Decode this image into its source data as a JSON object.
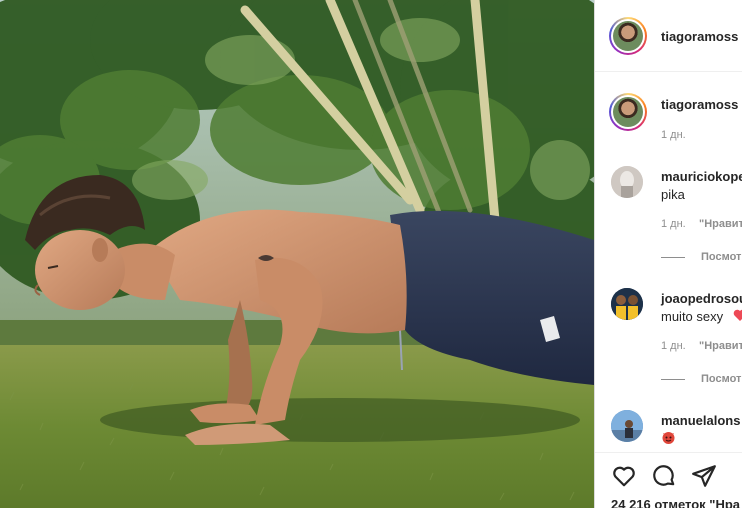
{
  "post": {
    "author": "tiagoramoss",
    "caption_author": "tiagoramoss",
    "caption_time": "1 дн."
  },
  "comments": [
    {
      "user": "mauriciokope",
      "text": "pika",
      "time": "1 дн.",
      "like_label": "\"Нравит",
      "replies": "Посмот"
    },
    {
      "user": "joaopedrosou",
      "text": "muito sexy",
      "time": "1 дн.",
      "like_label": "\"Нравит",
      "replies": "Посмот"
    },
    {
      "user": "manuelalons"
    }
  ],
  "actions": {
    "like_icon": "heart-outline-icon",
    "comment_icon": "speech-bubble-icon",
    "share_icon": "paper-plane-icon",
    "likes_text": "24 216 отметок \"Нра"
  },
  "colors": {
    "link_gray": "#8e8e8e",
    "text": "#262626",
    "heart_red": "#ed4956",
    "grass": "#6f8a3a"
  }
}
